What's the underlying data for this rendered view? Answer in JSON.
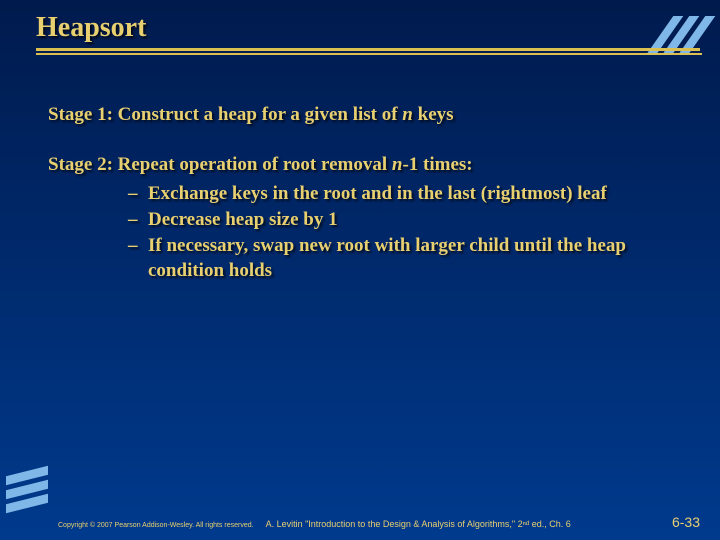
{
  "title": "Heapsort",
  "stage1": {
    "label": "Stage 1:",
    "text_before_n": " Construct a heap for a given list of ",
    "n": "n",
    "text_after_n": " keys"
  },
  "stage2": {
    "label": "Stage 2:",
    "text_before_n": " Repeat operation of root removal ",
    "n": "n",
    "text_after_n": "-1 times:",
    "bullets": [
      "Exchange keys in the root and in the last (rightmost) leaf",
      "Decrease heap size by 1",
      "If necessary,  swap new root with larger child until the heap condition holds"
    ]
  },
  "footer": {
    "copyright": "Copyright © 2007 Pearson Addison-Wesley. All rights reserved.",
    "attribution": "A. Levitin \"Introduction to the Design & Analysis of Algorithms,\" 2ⁿᵈ ed., Ch. 6",
    "page": "6-33"
  }
}
